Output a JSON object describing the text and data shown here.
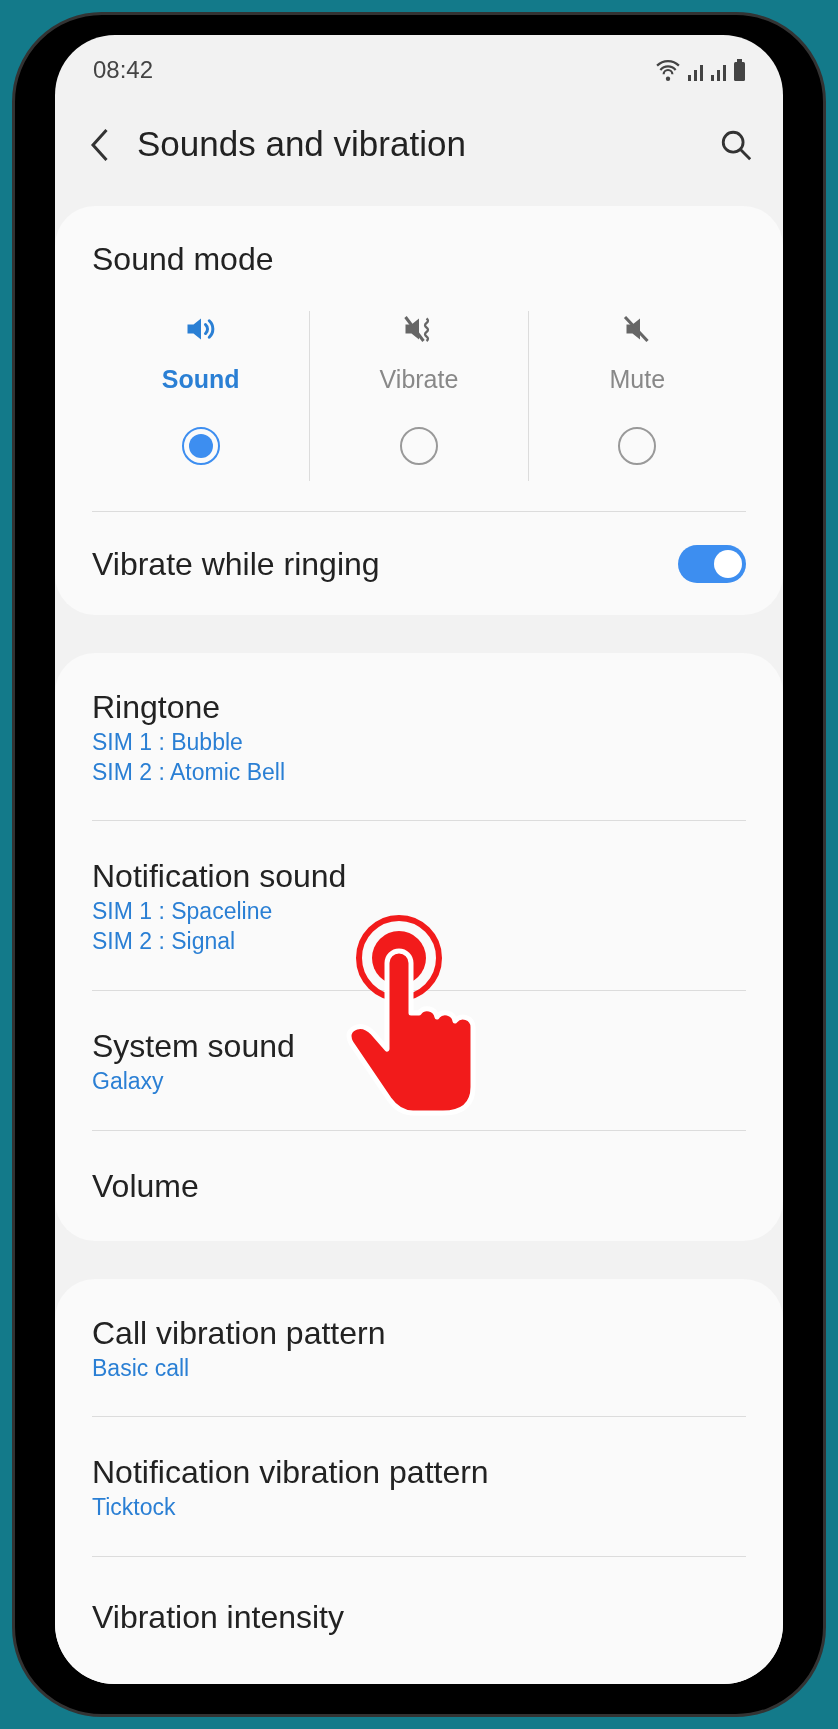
{
  "status_bar": {
    "time": "08:42"
  },
  "header": {
    "title": "Sounds and vibration"
  },
  "sound_mode": {
    "title": "Sound mode",
    "modes": [
      {
        "kind": "sound",
        "label": "Sound",
        "selected": true
      },
      {
        "kind": "vibrate",
        "label": "Vibrate",
        "selected": false
      },
      {
        "kind": "mute",
        "label": "Mute",
        "selected": false
      }
    ],
    "vibrate_while_ringing": {
      "label": "Vibrate while ringing",
      "on": true
    }
  },
  "sound_settings": [
    {
      "title": "Ringtone",
      "details": [
        "SIM 1 : Bubble",
        "SIM 2 : Atomic Bell"
      ]
    },
    {
      "title": "Notification sound",
      "details": [
        "SIM 1 : Spaceline",
        "SIM 2 : Signal"
      ]
    },
    {
      "title": "System sound",
      "details": [
        "Galaxy"
      ]
    },
    {
      "title": "Volume"
    }
  ],
  "vibration_settings": [
    {
      "title": "Call vibration pattern",
      "details": [
        "Basic call"
      ]
    },
    {
      "title": "Notification vibration pattern",
      "details": [
        "Ticktock"
      ]
    },
    {
      "title": "Vibration intensity"
    }
  ]
}
